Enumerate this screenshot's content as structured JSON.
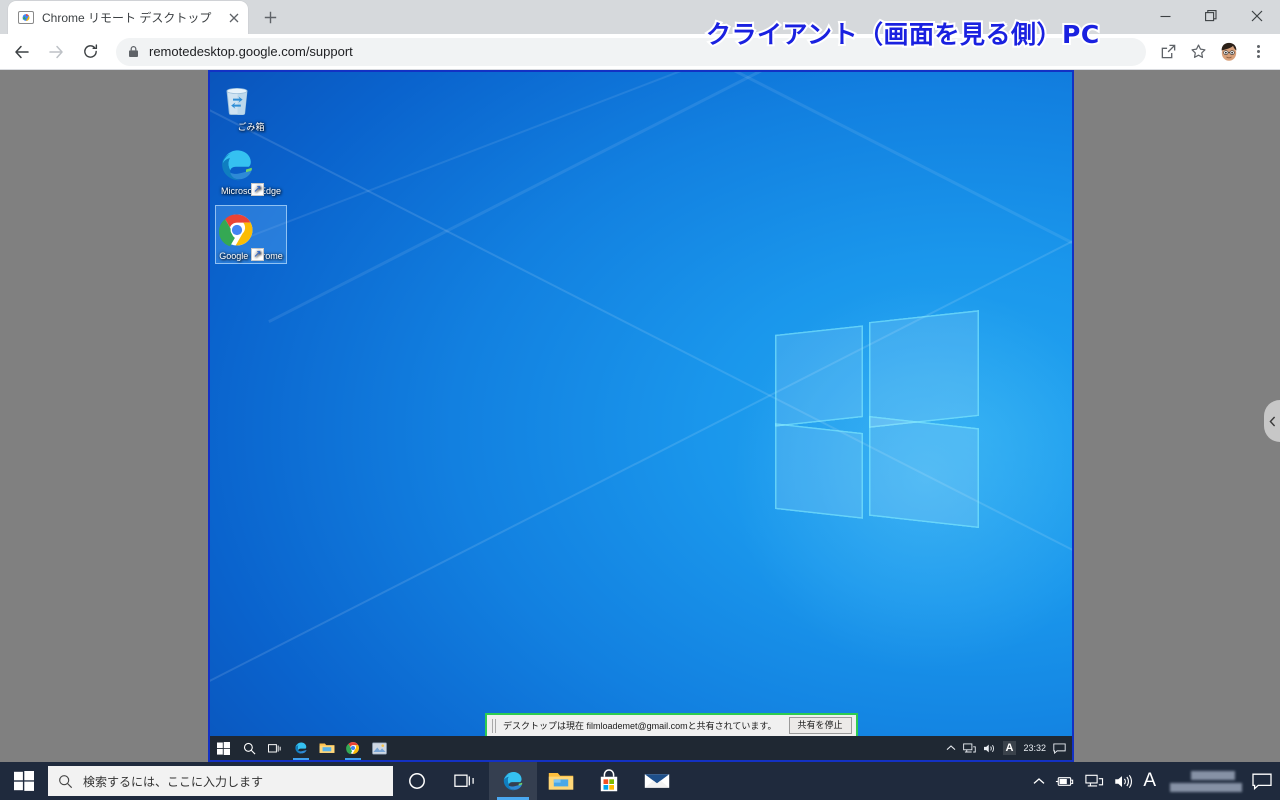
{
  "browser": {
    "tab": {
      "title": "Chrome リモート デスクトップ",
      "favicon_icon": "chrome-remote-desktop-icon",
      "close_icon": "close-icon"
    },
    "new_tab_label": "+",
    "window_controls": {
      "minimize": "minimize-icon",
      "maximize": "maximize-icon",
      "close": "close-icon"
    },
    "toolbar": {
      "back_icon": "back-arrow-icon",
      "forward_icon": "forward-arrow-icon",
      "reload_icon": "reload-icon",
      "lock_icon": "lock-icon",
      "url": "remotedesktop.google.com/support",
      "url_host": "remotedesktop.google.com",
      "url_path": "/support",
      "share_icon": "share-screen-icon",
      "bookmark_icon": "star-icon",
      "avatar_icon": "user-avatar-icon",
      "menu_icon": "three-dot-menu-icon"
    }
  },
  "annotation": {
    "text": "クライアント（画面を見る側）PC",
    "color": "#1a21e0",
    "outline_color": "#ffffff"
  },
  "panel_handle": {
    "icon": "chevron-left-icon"
  },
  "remote_desktop": {
    "frame_color": "#1331c4",
    "desktop_icons": [
      {
        "label": "ごみ箱",
        "icon": "recycle-bin-icon",
        "selected": false,
        "shortcut": false
      },
      {
        "label": "Microsoft Edge",
        "icon": "microsoft-edge-icon",
        "selected": false,
        "shortcut": true
      },
      {
        "label": "Google Chrome",
        "icon": "google-chrome-icon",
        "selected": true,
        "shortcut": true
      }
    ],
    "share_bar": {
      "message": "デスクトップは現在 filmloademet@gmail.comと共有されています。",
      "shared_email": "filmloademet@gmail.com",
      "stop_button_label": "共有を停止",
      "border_color": "#2ecc50"
    },
    "taskbar": {
      "items": [
        {
          "icon": "windows-start-icon",
          "running": false
        },
        {
          "icon": "search-icon",
          "running": false
        },
        {
          "icon": "task-view-icon",
          "running": false
        },
        {
          "icon": "microsoft-edge-icon",
          "running": true
        },
        {
          "icon": "file-explorer-icon",
          "running": false
        },
        {
          "icon": "google-chrome-icon",
          "running": true
        },
        {
          "icon": "photos-icon",
          "running": false
        }
      ],
      "tray": {
        "overflow_icon": "chevron-up-icon",
        "network_icon": "network-icon",
        "volume_icon": "volume-icon",
        "ime_label": "A",
        "clock": "23:32",
        "action_center_icon": "notification-icon"
      }
    }
  },
  "host_taskbar": {
    "start_icon": "windows-start-icon",
    "search": {
      "placeholder": "検索するには、ここに入力します",
      "icon": "search-icon"
    },
    "items": [
      {
        "icon": "cortana-icon",
        "active": false
      },
      {
        "icon": "task-view-icon",
        "active": false
      },
      {
        "icon": "microsoft-edge-icon",
        "active": true
      },
      {
        "icon": "file-explorer-icon",
        "active": false
      },
      {
        "icon": "microsoft-store-icon",
        "active": false
      },
      {
        "icon": "mail-icon",
        "active": false
      }
    ],
    "tray": {
      "overflow_icon": "chevron-up-icon",
      "battery_icon": "battery-charging-icon",
      "network_icon": "network-icon",
      "volume_icon": "volume-icon",
      "ime_label": "A",
      "clock_hidden": true,
      "action_center_icon": "notification-icon"
    }
  }
}
